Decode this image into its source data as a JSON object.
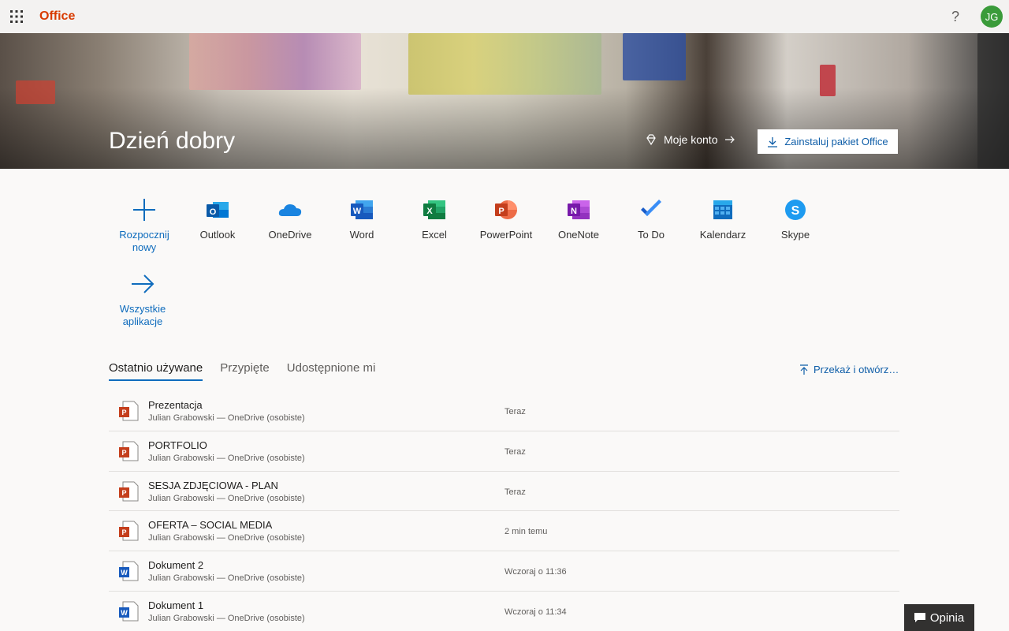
{
  "topbar": {
    "brand": "Office",
    "help": "?",
    "avatar_initials": "JG"
  },
  "hero": {
    "greeting": "Dzień dobry",
    "account_link": "Moje konto",
    "install_button": "Zainstaluj pakiet Office"
  },
  "apps": [
    {
      "label": "Rozpocznij nowy",
      "icon": "plus-icon"
    },
    {
      "label": "Outlook",
      "icon": "outlook-icon"
    },
    {
      "label": "OneDrive",
      "icon": "onedrive-icon"
    },
    {
      "label": "Word",
      "icon": "word-icon"
    },
    {
      "label": "Excel",
      "icon": "excel-icon"
    },
    {
      "label": "PowerPoint",
      "icon": "powerpoint-icon"
    },
    {
      "label": "OneNote",
      "icon": "onenote-icon"
    },
    {
      "label": "To Do",
      "icon": "todo-icon"
    },
    {
      "label": "Kalendarz",
      "icon": "calendar-icon"
    },
    {
      "label": "Skype",
      "icon": "skype-icon"
    },
    {
      "label": "Wszystkie aplikacje",
      "icon": "arrow-right-icon"
    }
  ],
  "tabs": [
    "Ostatnio używane",
    "Przypięte",
    "Udostępnione mi"
  ],
  "upload_link": "Przekaż i otwórz…",
  "files": [
    {
      "name": "Prezentacja",
      "meta": "Julian Grabowski — OneDrive (osobiste)",
      "date": "Teraz",
      "type": "powerpoint"
    },
    {
      "name": "PORTFOLIO",
      "meta": "Julian Grabowski — OneDrive (osobiste)",
      "date": "Teraz",
      "type": "powerpoint"
    },
    {
      "name": "SESJA ZDJĘCIOWA - PLAN",
      "meta": "Julian Grabowski — OneDrive (osobiste)",
      "date": "Teraz",
      "type": "powerpoint"
    },
    {
      "name": "OFERTA – SOCIAL MEDIA",
      "meta": "Julian Grabowski — OneDrive (osobiste)",
      "date": "2 min temu",
      "type": "powerpoint"
    },
    {
      "name": "Dokument 2",
      "meta": "Julian Grabowski — OneDrive (osobiste)",
      "date": "Wczoraj o 11:36",
      "type": "word"
    },
    {
      "name": "Dokument 1",
      "meta": "Julian Grabowski — OneDrive (osobiste)",
      "date": "Wczoraj o 11:34",
      "type": "word"
    }
  ],
  "feedback": "Opinia",
  "colors": {
    "brand": "#d83b01",
    "link": "#0f6cbd",
    "avatar": "#3a9b3a"
  }
}
